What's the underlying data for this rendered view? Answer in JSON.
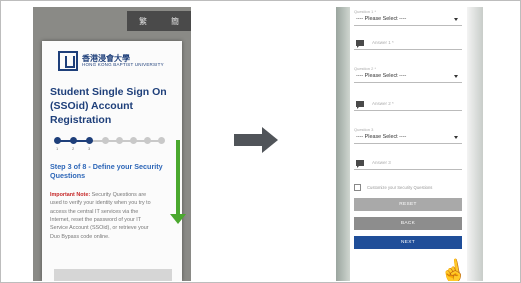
{
  "left_screen": {
    "language_toggle": [
      "繁",
      "簡"
    ],
    "logo": {
      "chinese": "香港浸會大學",
      "english": "HONG KONG BAPTIST UNIVERSITY"
    },
    "title": "Student Single Sign On (SSOid) Account Registration",
    "stepper": {
      "total_steps": 8,
      "current_step": 3,
      "labels": [
        "1",
        "2",
        "3"
      ]
    },
    "step_heading": "Step 3 of 8 - Define your Security Questions",
    "note": {
      "label": "Important Note:",
      "text": " Security Questions are used to verify your identity when you try to access the central IT services via the Internet, reset the password of your IT Service Account (SSOid), or retrieve your Duo Bypass code online."
    },
    "colors": {
      "brand": "#1e3f7a",
      "step_heading": "#2e67b8",
      "scroll_arrow": "#4aa82e",
      "important": "#c62828"
    }
  },
  "transition_arrow": "arrow-right-icon",
  "right_screen": {
    "questions": [
      {
        "label": "Question 1 *",
        "select_value": "---- Please Select ----",
        "answer_placeholder": "Answer 1 *"
      },
      {
        "label": "Question 2 *",
        "select_value": "---- Please Select ----",
        "answer_placeholder": "Answer 2 *"
      },
      {
        "label": "Question 3",
        "select_value": "---- Please Select ----",
        "answer_placeholder": "Answer 3"
      }
    ],
    "customize_label": "Customize your Security Questions",
    "buttons": {
      "reset": "RESET",
      "back": "BACK",
      "next": "NEXT"
    },
    "colors": {
      "reset": "#a9a9a9",
      "back": "#8d8d8d",
      "next": "#1f4e99"
    },
    "pointer": "hand-cursor-icon"
  }
}
